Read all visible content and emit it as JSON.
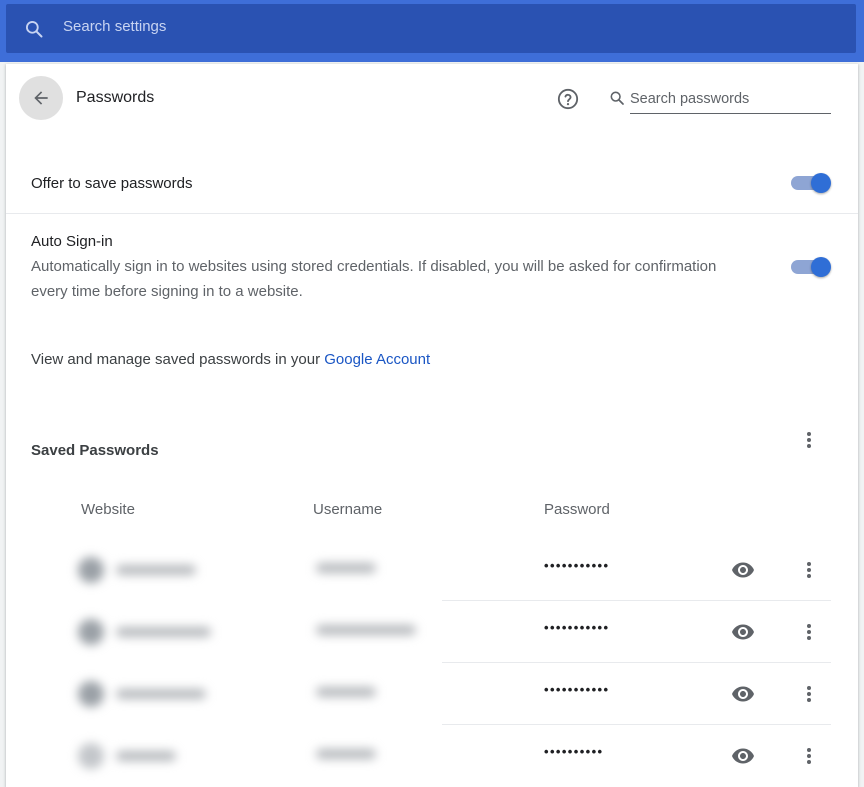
{
  "search": {
    "placeholder": "Search settings"
  },
  "page": {
    "title": "Passwords"
  },
  "password_search": {
    "placeholder": "Search passwords"
  },
  "offer_to_save": {
    "label": "Offer to save passwords",
    "enabled": true
  },
  "auto_signin": {
    "label": "Auto Sign-in",
    "description": "Automatically sign in to websites using stored credentials. If disabled, you will be asked for confirmation every time before signing in to a website.",
    "enabled": true
  },
  "manage": {
    "text": "View and manage saved passwords in your ",
    "link": "Google Account"
  },
  "saved": {
    "title": "Saved Passwords",
    "columns": {
      "website": "Website",
      "username": "Username",
      "password": "Password"
    },
    "rows": [
      {
        "password": "•••••••••••"
      },
      {
        "password": "•••••••••••"
      },
      {
        "password": "•••••••••••"
      },
      {
        "password": "••••••••••"
      }
    ]
  },
  "colors": {
    "accent": "#3e6ed8",
    "toggle_on": "#2f6ed6",
    "link": "#1a56c4"
  }
}
